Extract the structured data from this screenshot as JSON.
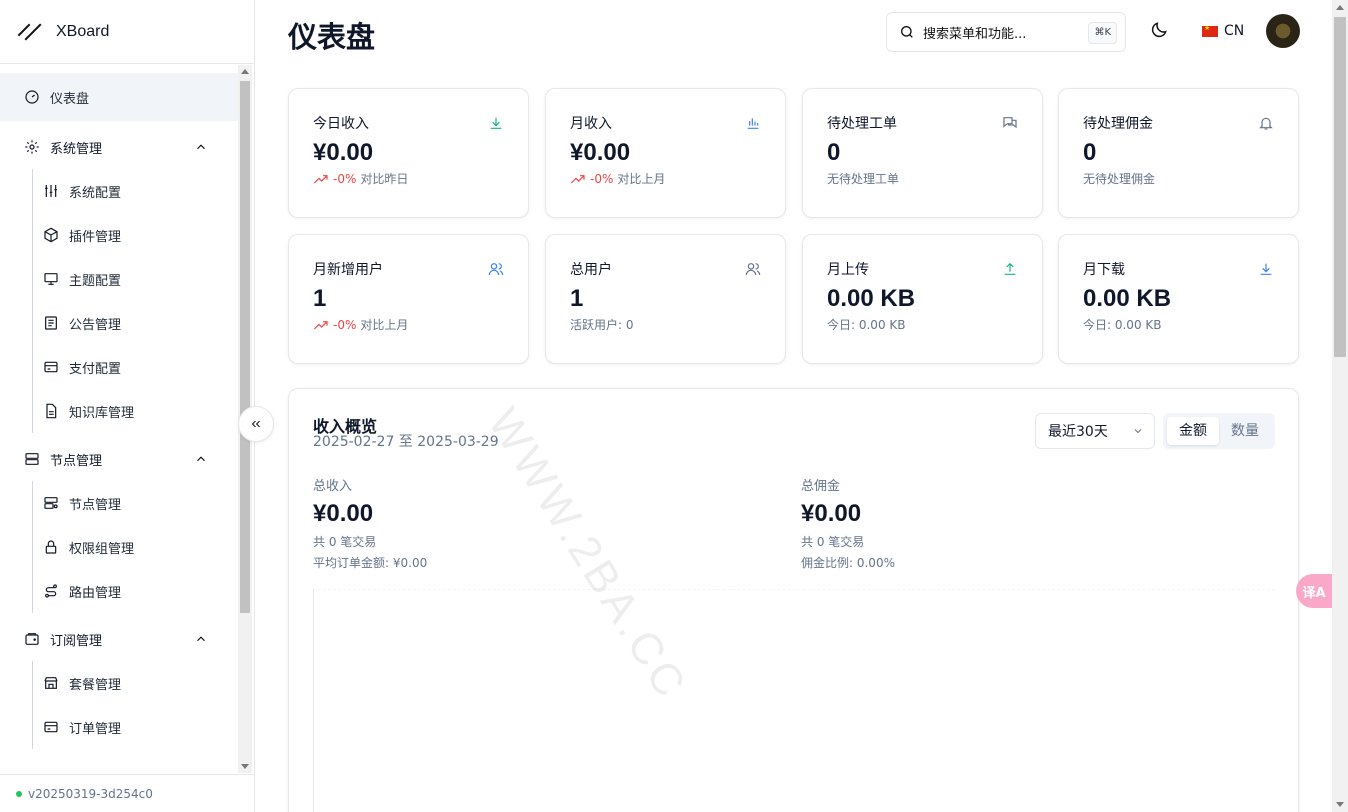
{
  "app": {
    "name": "XBoard",
    "version": "v20250319-3d254c0"
  },
  "sidebar": {
    "dashboard": "仪表盘",
    "groups": [
      {
        "label": "系统管理",
        "items": [
          "系统配置",
          "插件管理",
          "主题配置",
          "公告管理",
          "支付配置",
          "知识库管理"
        ]
      },
      {
        "label": "节点管理",
        "items": [
          "节点管理",
          "权限组管理",
          "路由管理"
        ]
      },
      {
        "label": "订阅管理",
        "items": [
          "套餐管理",
          "订单管理"
        ]
      }
    ]
  },
  "header": {
    "title": "仪表盘",
    "search_placeholder": "搜索菜单和功能...",
    "search_shortcut": "⌘K",
    "language": "CN"
  },
  "cards": [
    {
      "label": "今日收入",
      "value": "¥0.00",
      "trend": "-0%",
      "note": "对比昨日",
      "icon": "download-icon",
      "icon_color": "#10b981"
    },
    {
      "label": "月收入",
      "value": "¥0.00",
      "trend": "-0%",
      "note": "对比上月",
      "icon": "bar-chart-icon",
      "icon_color": "#3b82f6"
    },
    {
      "label": "待处理工单",
      "value": "0",
      "trend": "",
      "note": "无待处理工单",
      "icon": "messages-icon",
      "icon_color": "#64748b"
    },
    {
      "label": "待处理佣金",
      "value": "0",
      "trend": "",
      "note": "无待处理佣金",
      "icon": "bell-icon",
      "icon_color": "#64748b"
    },
    {
      "label": "月新增用户",
      "value": "1",
      "trend": "-0%",
      "note": "对比上月",
      "icon": "users-icon",
      "icon_color": "#3b82f6"
    },
    {
      "label": "总用户",
      "value": "1",
      "trend": "",
      "note": "活跃用户: 0",
      "icon": "users-icon",
      "icon_color": "#64748b"
    },
    {
      "label": "月上传",
      "value": "0.00 KB",
      "trend": "",
      "note": "今日: 0.00 KB",
      "icon": "upload-icon",
      "icon_color": "#10b981"
    },
    {
      "label": "月下载",
      "value": "0.00 KB",
      "trend": "",
      "note": "今日: 0.00 KB",
      "icon": "download-icon",
      "icon_color": "#3b82f6"
    }
  ],
  "overview": {
    "title": "收入概览",
    "range": "2025-02-27 至 2025-03-29",
    "period_select": "最近30天",
    "toggle": [
      "金额",
      "数量"
    ],
    "total_income": {
      "label": "总收入",
      "value": "¥0.00",
      "count": "共 0 笔交易",
      "extra": "平均订单金额: ¥0.00"
    },
    "total_commission": {
      "label": "总佣金",
      "value": "¥0.00",
      "count": "共 0 笔交易",
      "extra": "佣金比例: 0.00%"
    }
  },
  "watermark": "WWW.2BA.CC",
  "translate_fab": "译A"
}
